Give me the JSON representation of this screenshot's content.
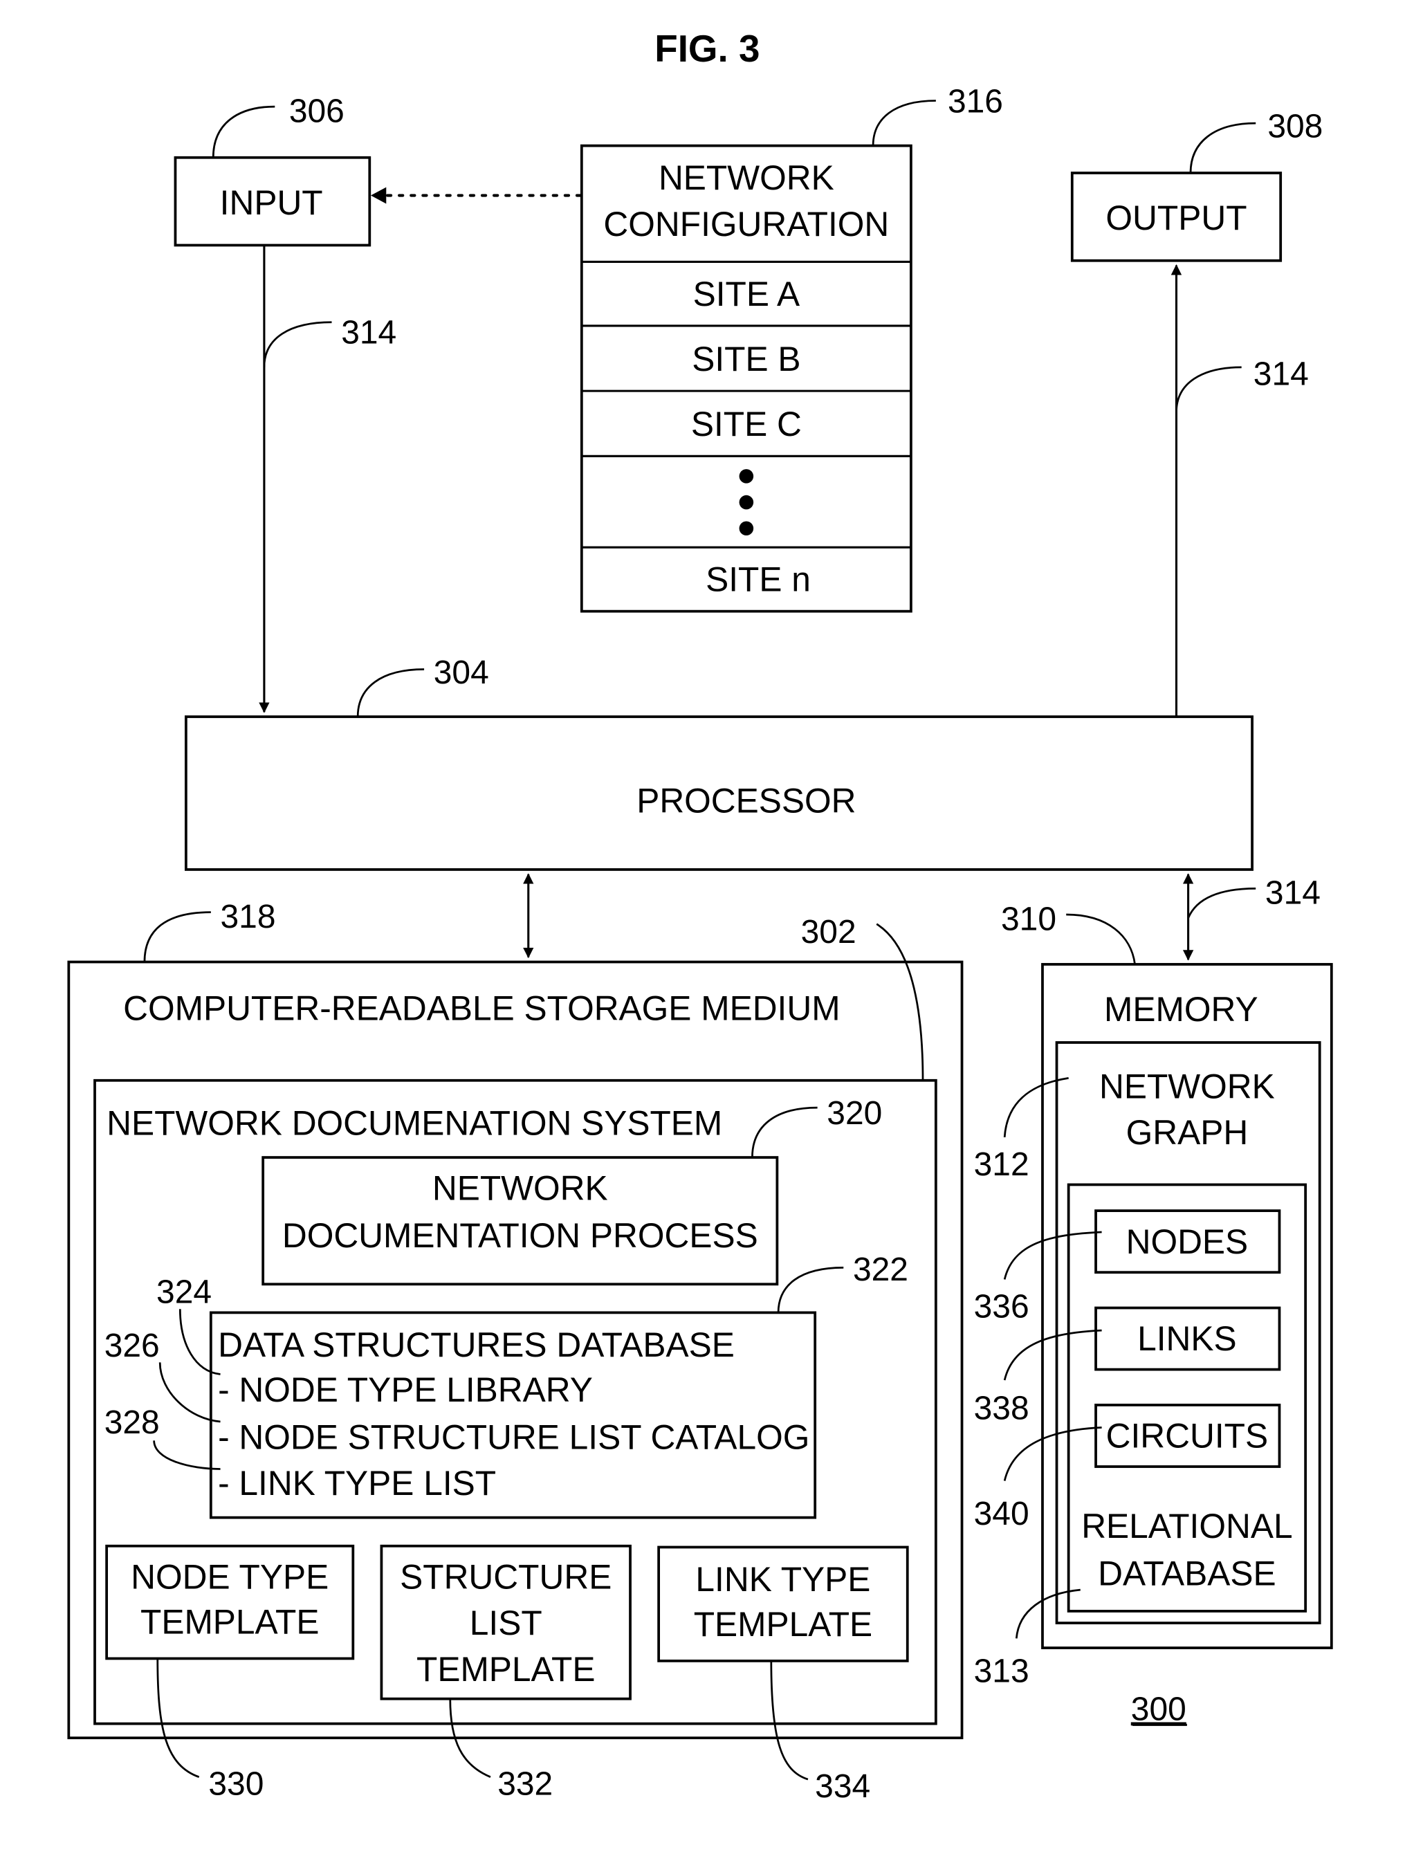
{
  "figure": {
    "title": "FIG. 3",
    "system_ref": "300"
  },
  "input": {
    "label": "INPUT",
    "ref": "306"
  },
  "output": {
    "label": "OUTPUT",
    "ref": "308"
  },
  "network_configuration": {
    "ref": "316",
    "header_line1": "NETWORK",
    "header_line2": "CONFIGURATION",
    "sites": [
      "SITE A",
      "SITE B",
      "SITE C",
      "SITE n"
    ]
  },
  "bus_refs": {
    "input_bus": "314",
    "output_bus": "314",
    "memory_bus": "314"
  },
  "processor": {
    "label": "PROCESSOR",
    "ref": "304"
  },
  "storage": {
    "ref": "318",
    "label": "COMPUTER-READABLE STORAGE MEDIUM",
    "system_ref": "302",
    "system_label": "NETWORK DOCUMENATION SYSTEM",
    "process": {
      "ref": "320",
      "line1": "NETWORK",
      "line2": "DOCUMENTATION PROCESS"
    },
    "database": {
      "ref": "322",
      "title": "DATA STRUCTURES DATABASE",
      "items": [
        {
          "ref": "324",
          "label": "- NODE TYPE LIBRARY"
        },
        {
          "ref": "326",
          "label": "- NODE STRUCTURE LIST CATALOG"
        },
        {
          "ref": "328",
          "label": "- LINK TYPE LIST"
        }
      ]
    },
    "templates": [
      {
        "ref": "330",
        "lines": [
          "NODE TYPE",
          "TEMPLATE"
        ]
      },
      {
        "ref": "332",
        "lines": [
          "STRUCTURE",
          "LIST",
          "TEMPLATE"
        ]
      },
      {
        "ref": "334",
        "lines": [
          "LINK TYPE",
          "TEMPLATE"
        ]
      }
    ]
  },
  "memory": {
    "ref": "310",
    "label": "MEMORY",
    "graph": {
      "ref": "312",
      "line1": "NETWORK",
      "line2": "GRAPH"
    },
    "relational_db": {
      "ref": "313",
      "line1": "RELATIONAL",
      "line2": "DATABASE",
      "items": [
        {
          "ref": "336",
          "label": "NODES"
        },
        {
          "ref": "338",
          "label": "LINKS"
        },
        {
          "ref": "340",
          "label": "CIRCUITS"
        }
      ]
    }
  }
}
